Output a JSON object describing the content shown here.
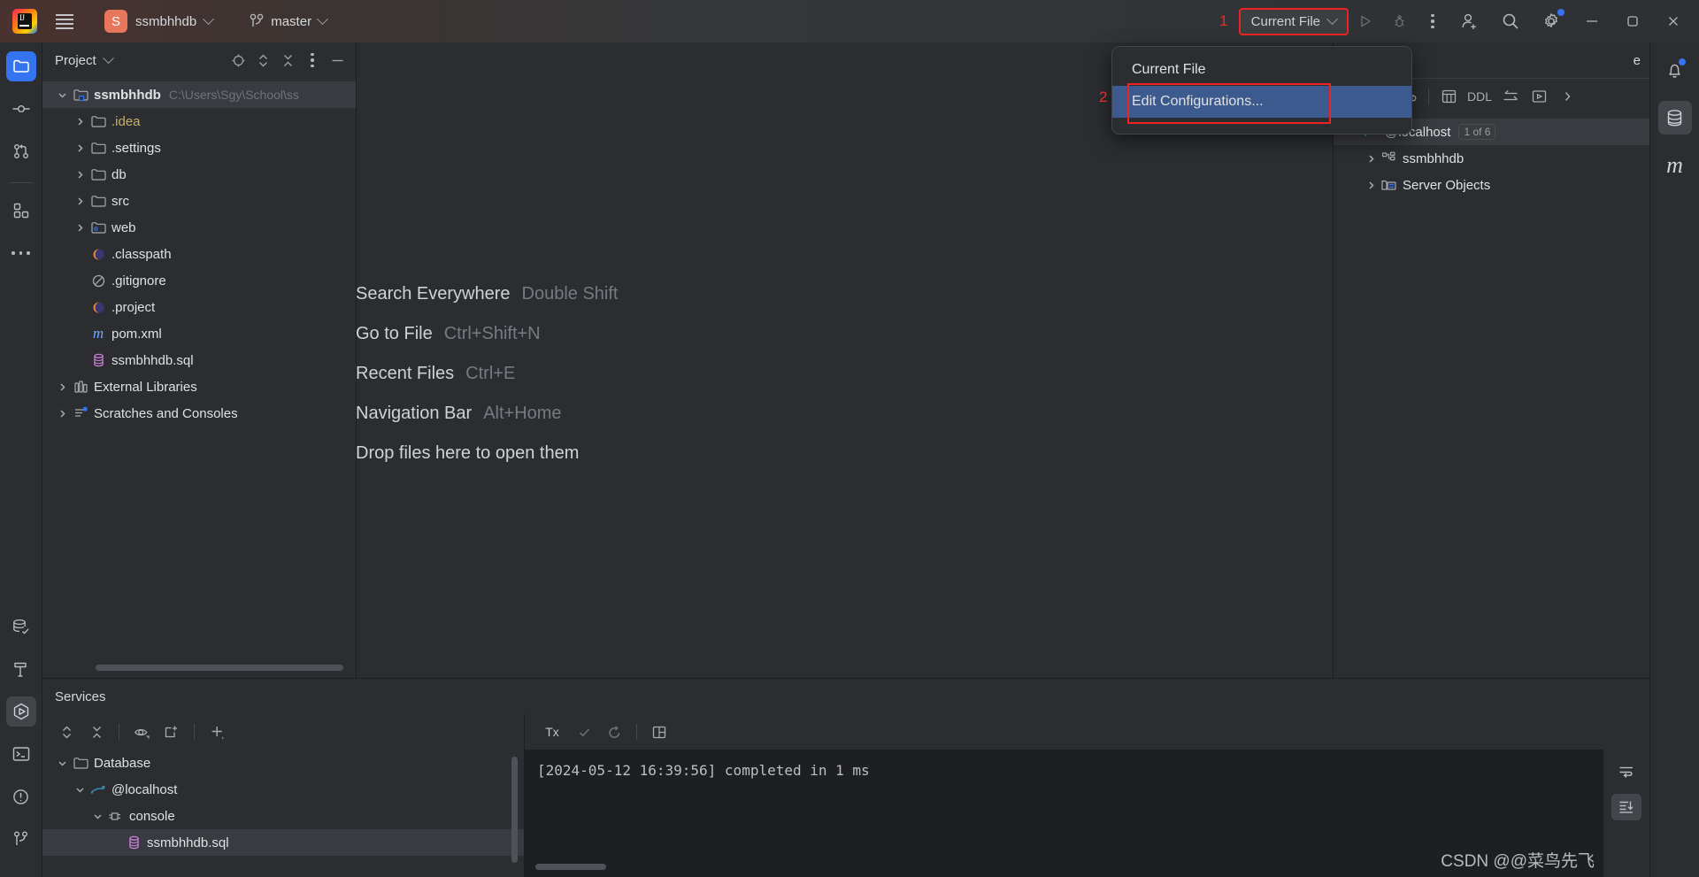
{
  "titlebar": {
    "logo_icon": "intellij-idea-logo",
    "menu_icon": "hamburger-menu-icon",
    "project_badge": "S",
    "project_name": "ssmbhhdb",
    "branch_icon": "git-branch-icon",
    "branch_name": "master",
    "annotation_1": "1",
    "run_config_label": "Current File",
    "run_icon": "run-triangle-icon",
    "debug_icon": "debug-bug-icon",
    "more_icon": "kebab-more-icon",
    "account_icon": "add-account-icon",
    "search_icon": "search-icon",
    "settings_icon": "gear-icon",
    "minimize_icon": "minimize-icon",
    "maximize_icon": "maximize-restore-icon",
    "close_icon": "close-icon"
  },
  "run_config_popup": {
    "items": [
      {
        "label": "Current File",
        "highlighted": false
      },
      {
        "label": "Edit Configurations...",
        "highlighted": true
      }
    ],
    "annotation_2": "2"
  },
  "left_rail": {
    "top_items": [
      {
        "name": "project-icon",
        "active": true
      },
      {
        "name": "commit-icon",
        "active": false
      },
      {
        "name": "pull-requests-icon",
        "active": false
      }
    ],
    "mid_items": [
      {
        "name": "structure-icon",
        "active": false
      },
      {
        "name": "more-tool-windows-icon",
        "active": false
      }
    ],
    "bottom_items": [
      {
        "name": "database-icon",
        "active": false
      },
      {
        "name": "build-hammer-icon",
        "active": false
      },
      {
        "name": "services-run-icon",
        "active": true
      },
      {
        "name": "terminal-icon",
        "active": false
      },
      {
        "name": "problems-icon",
        "active": false
      },
      {
        "name": "version-control-icon",
        "active": false
      }
    ]
  },
  "project_panel": {
    "title": "Project",
    "title_chevron": "chevron-down-icon",
    "actions": [
      {
        "name": "select-opened-file-icon"
      },
      {
        "name": "expand-collapse-icon"
      },
      {
        "name": "collapse-all-icon"
      },
      {
        "name": "options-kebab-icon"
      },
      {
        "name": "hide-panel-icon"
      }
    ],
    "tree": [
      {
        "indent": 0,
        "arrow": "down",
        "icon": "module-folder-icon",
        "label": "ssmbhhdb",
        "bold": true,
        "path": "C:\\Users\\Sgy\\School\\ss",
        "selected": true
      },
      {
        "indent": 1,
        "arrow": "right",
        "icon": "folder-icon",
        "label": ".idea",
        "yellow": true
      },
      {
        "indent": 1,
        "arrow": "right",
        "icon": "folder-icon",
        "label": ".settings"
      },
      {
        "indent": 1,
        "arrow": "right",
        "icon": "folder-icon",
        "label": "db"
      },
      {
        "indent": 1,
        "arrow": "right",
        "icon": "folder-icon",
        "label": "src"
      },
      {
        "indent": 1,
        "arrow": "right",
        "icon": "web-folder-icon",
        "label": "web"
      },
      {
        "indent": 2,
        "arrow": "none",
        "icon": "eclipse-file-icon",
        "label": ".classpath"
      },
      {
        "indent": 2,
        "arrow": "none",
        "icon": "gitignore-icon",
        "label": ".gitignore"
      },
      {
        "indent": 2,
        "arrow": "none",
        "icon": "eclipse-file-icon",
        "label": ".project"
      },
      {
        "indent": 2,
        "arrow": "none",
        "icon": "maven-m-icon",
        "label": "pom.xml"
      },
      {
        "indent": 2,
        "arrow": "none",
        "icon": "sql-file-icon",
        "label": "ssmbhhdb.sql"
      },
      {
        "indent": 0,
        "arrow": "right",
        "icon": "external-libraries-icon",
        "label": "External Libraries"
      },
      {
        "indent": 0,
        "arrow": "right",
        "icon": "scratches-icon",
        "label": "Scratches and Consoles"
      }
    ]
  },
  "editor": {
    "hints": [
      {
        "action": "Search Everywhere",
        "shortcut": "Double Shift"
      },
      {
        "action": "Go to File",
        "shortcut": "Ctrl+Shift+N"
      },
      {
        "action": "Recent Files",
        "shortcut": "Ctrl+E"
      },
      {
        "action": "Navigation Bar",
        "shortcut": "Alt+Home"
      },
      {
        "action": "Drop files here to open them",
        "shortcut": ""
      }
    ]
  },
  "database_panel": {
    "title_fragment": "e",
    "toolbar": [
      {
        "name": "refresh-icon"
      },
      {
        "name": "data-source-properties-icon"
      },
      {
        "name": "new-query-console-icon"
      },
      {
        "name": "table-editor-icon"
      },
      {
        "name": "ddl-button",
        "label": "DDL"
      },
      {
        "name": "jump-to-editor-icon"
      },
      {
        "name": "open-console-icon"
      },
      {
        "name": "more-chevron-icon"
      }
    ],
    "tree": [
      {
        "indent": 0,
        "arrow": "down",
        "icon": "mysql-datasource-icon",
        "label": "@localhost",
        "badge": "1 of 6",
        "selected": true
      },
      {
        "indent": 1,
        "arrow": "right",
        "icon": "schema-icon",
        "label": "ssmbhhdb"
      },
      {
        "indent": 1,
        "arrow": "right",
        "icon": "server-objects-icon",
        "label": "Server Objects"
      }
    ]
  },
  "right_rail": {
    "items": [
      {
        "name": "notifications-bell-icon",
        "active": false,
        "dot": true
      },
      {
        "name": "database-tool-icon",
        "active": true
      },
      {
        "name": "maven-tool-icon",
        "active": false,
        "glyph": "m"
      }
    ]
  },
  "services": {
    "title": "Services",
    "toolbar": [
      {
        "name": "expand-collapse-icon"
      },
      {
        "name": "collapse-all-icon"
      },
      {
        "name": "show-hide-icon"
      },
      {
        "name": "new-tab-icon"
      },
      {
        "name": "add-service-icon"
      }
    ],
    "tree": [
      {
        "indent": 0,
        "arrow": "down",
        "icon": "folder-icon",
        "label": "Database"
      },
      {
        "indent": 1,
        "arrow": "down",
        "icon": "mysql-datasource-icon",
        "label": "@localhost"
      },
      {
        "indent": 2,
        "arrow": "down",
        "icon": "console-icon",
        "label": "console"
      },
      {
        "indent": 3,
        "arrow": "none",
        "icon": "sql-file-icon",
        "label": "ssmbhhdb.sql",
        "selected": true
      }
    ],
    "console_toolbar": [
      {
        "name": "transaction-mode-icon",
        "label": "Tx"
      },
      {
        "name": "commit-check-icon"
      },
      {
        "name": "rollback-icon"
      },
      {
        "name": "toggle-layout-icon"
      }
    ],
    "console_output": "[2024-05-12 16:39:56] completed in 1 ms",
    "console_side": [
      {
        "name": "soft-wrap-icon",
        "active": false
      },
      {
        "name": "scroll-to-end-icon",
        "active": true
      }
    ]
  },
  "watermark": "CSDN @@菜鸟先飞"
}
